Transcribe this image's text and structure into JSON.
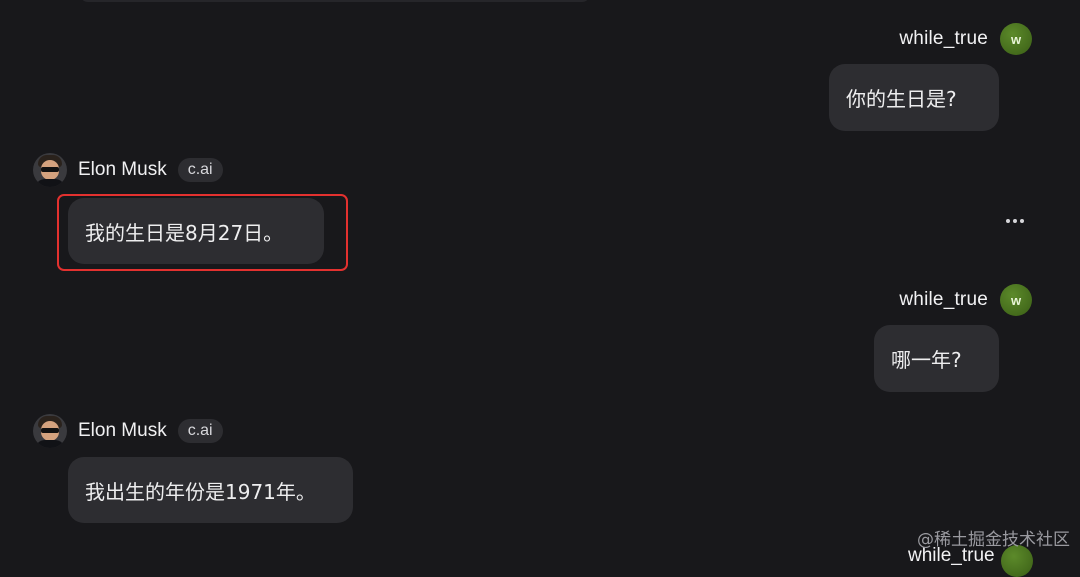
{
  "messages": [
    {
      "sender": "while_true",
      "role": "user",
      "avatar_letter": "w",
      "text": "你的生日是?"
    },
    {
      "sender": "Elon Musk",
      "role": "bot",
      "badge": "c.ai",
      "text": "我的生日是8月27日。"
    },
    {
      "sender": "while_true",
      "role": "user",
      "avatar_letter": "w",
      "text": "哪一年?"
    },
    {
      "sender": "Elon Musk",
      "role": "bot",
      "badge": "c.ai",
      "text": "我出生的年份是1971年。"
    }
  ],
  "watermark": "@稀土掘金技术社区",
  "partial_next_sender": "while_true",
  "colors": {
    "background": "#18181b",
    "bubble": "#2d2d31",
    "highlight": "#e3312f",
    "user_avatar": "#4a7320"
  },
  "icons": {
    "more": "ellipsis-icon"
  }
}
